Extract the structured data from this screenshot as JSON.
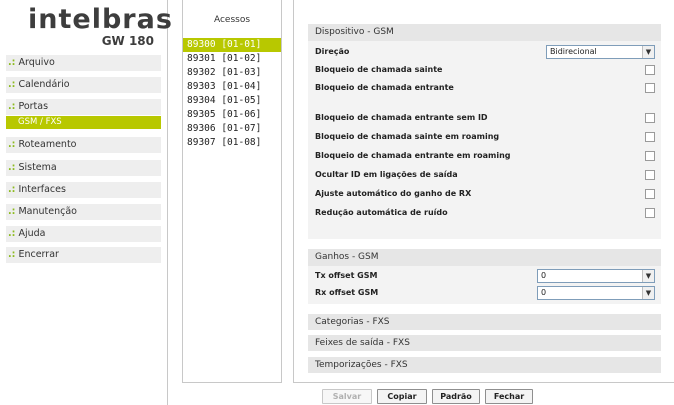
{
  "logo": {
    "brand": "intelbras",
    "model": "GW 180"
  },
  "menu": {
    "prefix": ".:",
    "items": [
      "Arquivo",
      "Calendário",
      "Portas",
      "Roteamento",
      "Sistema",
      "Interfaces",
      "Manutenção",
      "Ajuda",
      "Encerrar"
    ],
    "sub_item": "GSM / FXS"
  },
  "accesses": {
    "title": "Acessos",
    "items": [
      "89300 [01-01]",
      "89301 [01-02]",
      "89302 [01-03]",
      "89303 [01-04]",
      "89304 [01-05]",
      "89305 [01-06]",
      "89306 [01-07]",
      "89307 [01-08]"
    ],
    "selected_index": 0
  },
  "gsm": {
    "title": "Dispositivo - GSM",
    "direction_label": "Direção",
    "direction_value": "Bidirecional",
    "options": [
      "Bloqueio de chamada sainte",
      "Bloqueio de chamada entrante",
      "Bloqueio de chamada entrante sem ID",
      "Bloqueio de chamada sainte em roaming",
      "Bloqueio de chamada entrante em roaming",
      "Ocultar ID em ligações de saída",
      "Ajuste automático do ganho de RX",
      "Redução automática de ruído"
    ]
  },
  "gains": {
    "title": "Ganhos - GSM",
    "tx_label": "Tx offset GSM",
    "tx_value": "0",
    "rx_label": "Rx offset GSM",
    "rx_value": "0"
  },
  "sections": [
    "Categorias - FXS",
    "Feixes de saída - FXS",
    "Temporizações - FXS"
  ],
  "buttons": {
    "save": "Salvar",
    "copy": "Copiar",
    "default": "Padrão",
    "close": "Fechar"
  },
  "icons": {
    "dropdown": "chevron-down-icon"
  },
  "colors": {
    "accent": "#b8c800",
    "menu_prefix": "#8cbb1e"
  }
}
